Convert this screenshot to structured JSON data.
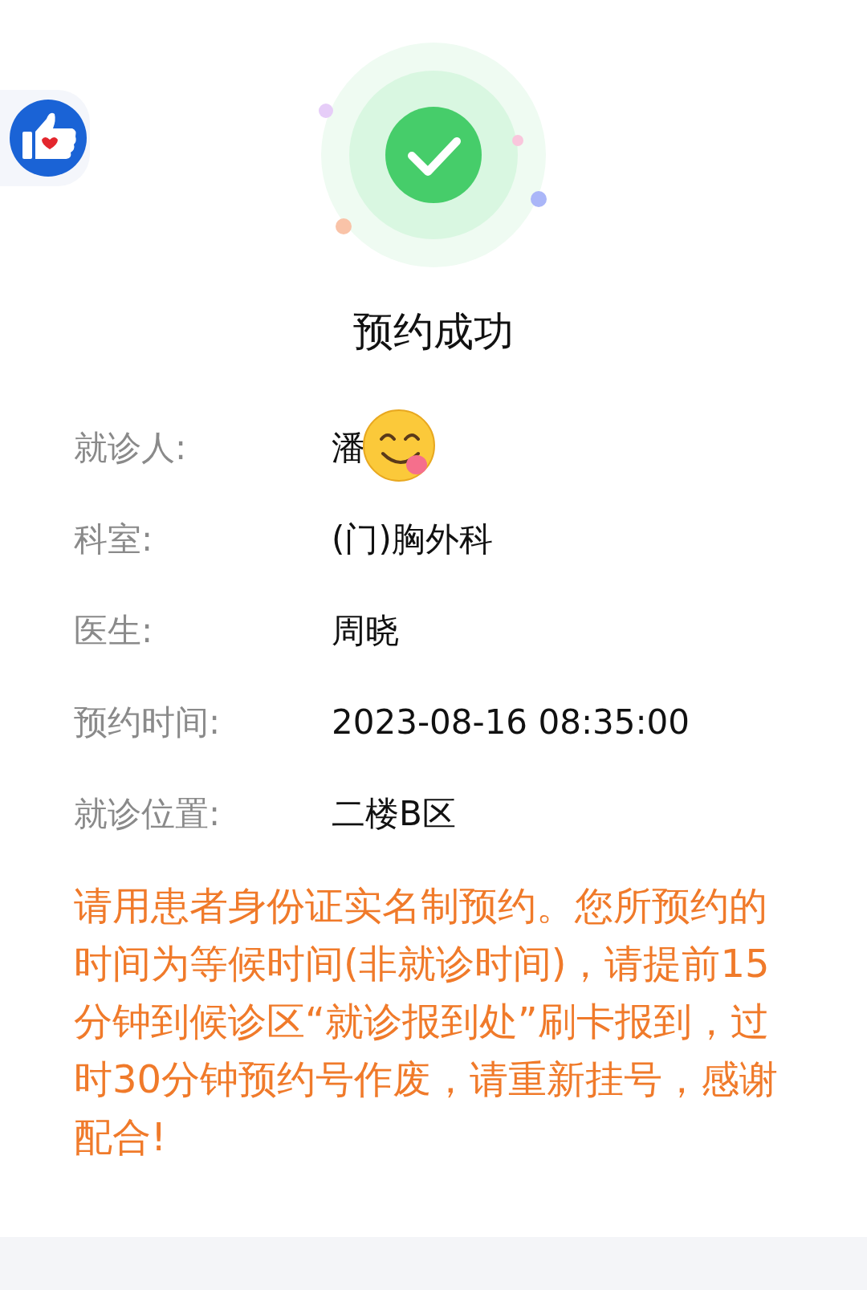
{
  "status": {
    "title": "预约成功"
  },
  "details": [
    {
      "label": "就诊人:",
      "value": "潘"
    },
    {
      "label": "科室:",
      "value": "(门)胸外科"
    },
    {
      "label": "医生:",
      "value": "周晓"
    },
    {
      "label": "预约时间:",
      "value": "2023-08-16 08:35:00"
    },
    {
      "label": "就诊位置:",
      "value": "二楼B区"
    }
  ],
  "notice": "请用患者身份证实名制预约。您所预约的时间为等候时间(非就诊时间)，请提前15分钟到候诊区“就诊报到处”刷卡报到，过时30分钟预约号作废，请重新挂号，感谢配合!"
}
